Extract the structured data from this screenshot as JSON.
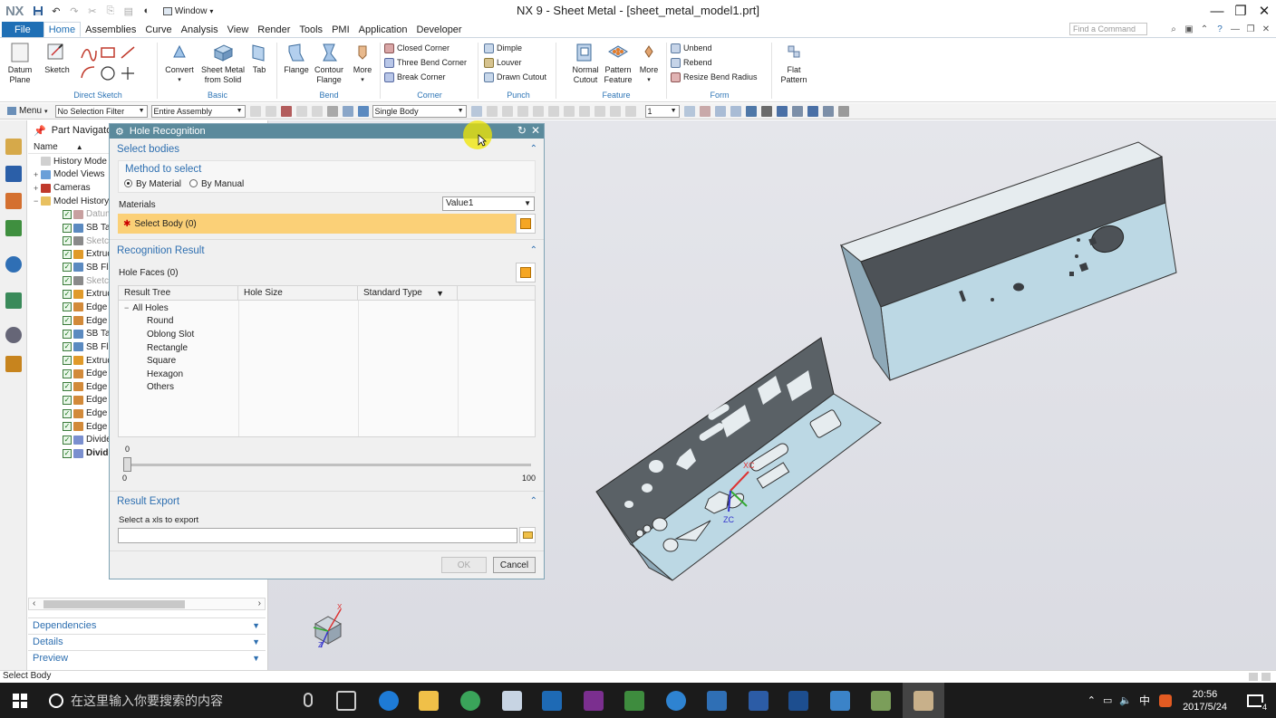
{
  "app": {
    "logo": "NX",
    "window_menu": "Window",
    "title": "NX 9 - Sheet Metal - [sheet_metal_model1.prt]"
  },
  "menu": {
    "tabs": [
      "File",
      "Home",
      "Assemblies",
      "Curve",
      "Analysis",
      "View",
      "Render",
      "Tools",
      "PMI",
      "Application",
      "Developer"
    ],
    "find_placeholder": "Find a Command"
  },
  "ribbon": {
    "datum_plane": [
      "Datum",
      "Plane"
    ],
    "sketch": "Sketch",
    "direct_sketch": "Direct Sketch",
    "convert": "Convert",
    "sheet_metal_from_solid": [
      "Sheet Metal",
      "from Solid"
    ],
    "tab": "Tab",
    "basic": "Basic",
    "flange": "Flange",
    "contour_flange": [
      "Contour",
      "Flange"
    ],
    "more_bend": "More",
    "bend": "Bend",
    "closed_corner": "Closed Corner",
    "three_bend_corner": "Three Bend Corner",
    "break_corner": "Break Corner",
    "corner": "Corner",
    "dimple": "Dimple",
    "louver": "Louver",
    "drawn_cutout": "Drawn Cutout",
    "punch": "Punch",
    "normal_cutout": [
      "Normal",
      "Cutout"
    ],
    "pattern_feature": [
      "Pattern",
      "Feature"
    ],
    "more_feature": "More",
    "feature": "Feature",
    "unbend": "Unbend",
    "rebend": "Rebend",
    "resize_bend_radius": "Resize Bend Radius",
    "form": "Form",
    "flat_pattern": [
      "Flat",
      "Pattern"
    ]
  },
  "toolbar": {
    "menu": "Menu",
    "selection_filter": "No Selection Filter",
    "assembly_scope": "Entire Assembly",
    "body_rule": "Single Body",
    "layer": "1"
  },
  "part_navigator": {
    "title": "Part Navigator",
    "col_name": "Name",
    "items": [
      {
        "label": "History Mode",
        "kind": "clock",
        "dim": false,
        "bold": false,
        "indent": 1
      },
      {
        "label": "Model Views",
        "kind": "views",
        "dim": false,
        "bold": false,
        "indent": 1,
        "expand": "+"
      },
      {
        "label": "Cameras",
        "kind": "camera",
        "dim": false,
        "bold": false,
        "indent": 1,
        "expand": "+"
      },
      {
        "label": "Model History",
        "kind": "folder",
        "dim": false,
        "bold": false,
        "indent": 1,
        "expand": "−"
      },
      {
        "label": "Datum C",
        "kind": "datum",
        "dim": true,
        "bold": false,
        "indent": 2
      },
      {
        "label": "SB Tab",
        "kind": "tab",
        "dim": false,
        "bold": false,
        "indent": 2
      },
      {
        "label": "Sketch (",
        "kind": "sketch",
        "dim": true,
        "bold": false,
        "indent": 2
      },
      {
        "label": "Extrude",
        "kind": "extrude",
        "dim": false,
        "bold": false,
        "indent": 2
      },
      {
        "label": "SB Flang",
        "kind": "flange",
        "dim": false,
        "bold": false,
        "indent": 2
      },
      {
        "label": "Sketch (",
        "kind": "sketch",
        "dim": true,
        "bold": false,
        "indent": 2
      },
      {
        "label": "Extrude",
        "kind": "extrude",
        "dim": false,
        "bold": false,
        "indent": 2
      },
      {
        "label": "Edge Bl",
        "kind": "blend",
        "dim": false,
        "bold": false,
        "indent": 2
      },
      {
        "label": "Edge Bl",
        "kind": "blend",
        "dim": false,
        "bold": false,
        "indent": 2
      },
      {
        "label": "SB Tab",
        "kind": "tab",
        "dim": false,
        "bold": false,
        "indent": 2
      },
      {
        "label": "SB Flang",
        "kind": "flange",
        "dim": false,
        "bold": false,
        "indent": 2
      },
      {
        "label": "Extrude",
        "kind": "extrude",
        "dim": false,
        "bold": false,
        "indent": 2
      },
      {
        "label": "Edge Bl",
        "kind": "blend",
        "dim": false,
        "bold": false,
        "indent": 2
      },
      {
        "label": "Edge Bl",
        "kind": "blend",
        "dim": false,
        "bold": false,
        "indent": 2
      },
      {
        "label": "Edge Bl",
        "kind": "blend",
        "dim": false,
        "bold": false,
        "indent": 2
      },
      {
        "label": "Edge Bl",
        "kind": "blend",
        "dim": false,
        "bold": false,
        "indent": 2
      },
      {
        "label": "Edge Bl",
        "kind": "blend",
        "dim": false,
        "bold": false,
        "indent": 2
      },
      {
        "label": "Divide F",
        "kind": "divide",
        "dim": false,
        "bold": false,
        "indent": 2
      },
      {
        "label": "Divide",
        "kind": "divide",
        "dim": false,
        "bold": true,
        "indent": 2
      }
    ],
    "panels": [
      "Dependencies",
      "Details",
      "Preview"
    ]
  },
  "dialog": {
    "title": "Hole Recognition",
    "select_bodies": "Select bodies",
    "method_to_select": "Method to select",
    "by_material": "By Material",
    "by_manual": "By Manual",
    "materials_label": "Materials",
    "materials_value": "Value1",
    "select_body": "Select Body (0)",
    "recognition_result": "Recognition Result",
    "hole_faces": "Hole Faces (0)",
    "columns": [
      "Result Tree",
      "Hole Size",
      "Standard Type"
    ],
    "tree_root": "All Holes",
    "tree_items": [
      "Round",
      "Oblong Slot",
      "Rectangle",
      "Square",
      "Hexagon",
      "Others"
    ],
    "slider_value": "0",
    "slider_min": "0",
    "slider_max": "100",
    "result_export": "Result Export",
    "select_xls": "Select a xls to export",
    "ok": "OK",
    "cancel": "Cancel"
  },
  "status": {
    "text": "Select Body"
  },
  "taskbar": {
    "search_placeholder": "在这里输入你要搜索的内容",
    "ime": "中",
    "time": "20:56",
    "date": "2017/5/24",
    "notif_count": "4"
  },
  "viewport": {
    "csys_x": "XC",
    "csys_z": "ZC",
    "triad_x": "X",
    "triad_z": "Z"
  },
  "colors": {
    "accent": "#2e6fb0",
    "dialog_title": "#5b8a9c",
    "select_highlight": "#fbd077",
    "part_face": "#bcd8e4",
    "part_dark": "#555b60"
  }
}
